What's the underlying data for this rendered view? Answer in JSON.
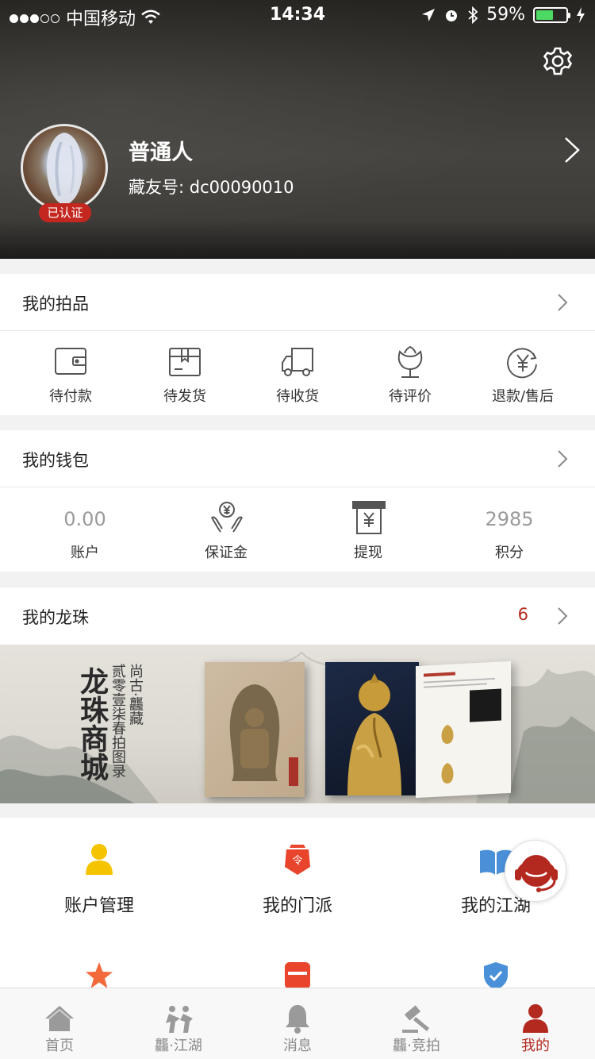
{
  "status_bar": {
    "carrier": "中国移动",
    "time": "14:34",
    "battery": "59%",
    "battery_level": 0.59
  },
  "profile": {
    "name": "普通人",
    "id_label": "藏友号: dc00090010",
    "badge": "已认证"
  },
  "auctions": {
    "title": "我的拍品",
    "items": [
      {
        "label": "待付款",
        "icon": "wallet-icon"
      },
      {
        "label": "待发货",
        "icon": "package-icon"
      },
      {
        "label": "待收货",
        "icon": "truck-icon"
      },
      {
        "label": "待评价",
        "icon": "flower-icon"
      },
      {
        "label": "退款/售后",
        "icon": "refund-icon"
      }
    ]
  },
  "wallet": {
    "title": "我的钱包",
    "items": [
      {
        "value": "0.00",
        "label": "账户"
      },
      {
        "label": "保证金",
        "icon": "deposit-hands-icon"
      },
      {
        "label": "提现",
        "icon": "withdraw-icon"
      },
      {
        "value": "2985",
        "label": "积分"
      }
    ]
  },
  "pearls": {
    "title": "我的龙珠",
    "count": "6"
  },
  "banner": {
    "title": "龙珠商城",
    "subtitle_1": "尚古·龘藏",
    "subtitle_2": "贰零壹柒春拍图录"
  },
  "menu": [
    {
      "label": "账户管理",
      "icon": "account-icon",
      "color": "#f5c400"
    },
    {
      "label": "我的门派",
      "icon": "sect-icon",
      "color": "#e8452c"
    },
    {
      "label": "我的江湖",
      "icon": "book-icon",
      "color": "#4a90d9"
    },
    {
      "label": "",
      "icon": "star-icon",
      "color": "#f26a3c"
    },
    {
      "label": "",
      "icon": "shop-icon",
      "color": "#e8452c"
    },
    {
      "label": "",
      "icon": "shield-check-icon",
      "color": "#4a90d9"
    }
  ],
  "tabs": [
    {
      "label": "首页",
      "icon": "home-icon"
    },
    {
      "label": "龘·江湖",
      "icon": "martial-icon"
    },
    {
      "label": "消息",
      "icon": "bell-icon"
    },
    {
      "label": "龘·竞拍",
      "icon": "gavel-icon"
    },
    {
      "label": "我的",
      "icon": "user-icon",
      "active": true
    }
  ],
  "accent_color": "#b3291f"
}
